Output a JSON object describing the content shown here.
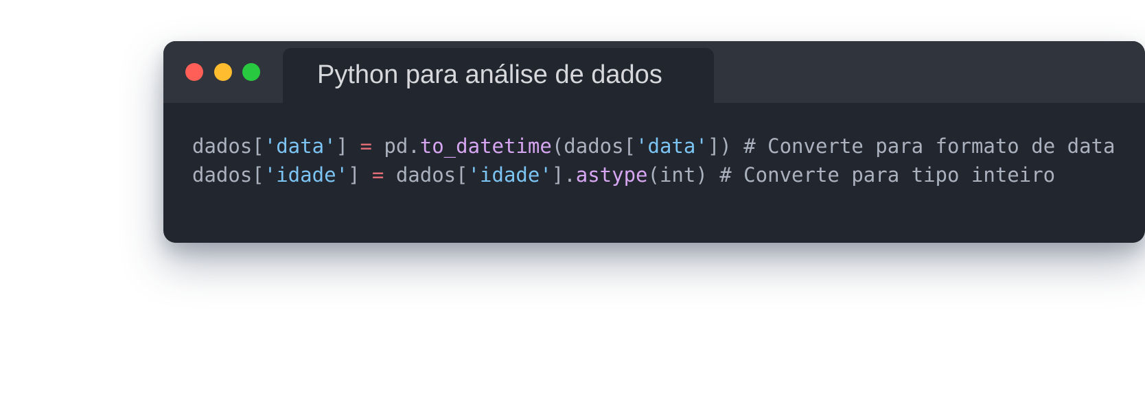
{
  "window": {
    "title": "Python para análise de dados",
    "controls": {
      "close_color": "#ff5f57",
      "minimize_color": "#febc2e",
      "maximize_color": "#28c840"
    }
  },
  "colors": {
    "window_background": "#22262e",
    "titlebar_background": "#30343c",
    "plain_text": "#abb2bf",
    "string": "#7cc4f3",
    "operator": "#e06c75",
    "function": "#d7a6f2"
  },
  "code": {
    "language": "python",
    "lines": [
      [
        {
          "type": "plain",
          "text": "dados["
        },
        {
          "type": "string",
          "text": "'data'"
        },
        {
          "type": "plain",
          "text": "] "
        },
        {
          "type": "operator",
          "text": "="
        },
        {
          "type": "plain",
          "text": " pd."
        },
        {
          "type": "function",
          "text": "to_datetime"
        },
        {
          "type": "plain",
          "text": "(dados["
        },
        {
          "type": "string",
          "text": "'data'"
        },
        {
          "type": "plain",
          "text": "]) "
        },
        {
          "type": "comment",
          "text": "# Converte para formato de data"
        }
      ],
      [
        {
          "type": "plain",
          "text": "dados["
        },
        {
          "type": "string",
          "text": "'idade'"
        },
        {
          "type": "plain",
          "text": "] "
        },
        {
          "type": "operator",
          "text": "="
        },
        {
          "type": "plain",
          "text": " dados["
        },
        {
          "type": "string",
          "text": "'idade'"
        },
        {
          "type": "plain",
          "text": "]."
        },
        {
          "type": "function",
          "text": "astype"
        },
        {
          "type": "plain",
          "text": "(int) "
        },
        {
          "type": "comment",
          "text": "# Converte para tipo inteiro"
        }
      ]
    ]
  }
}
